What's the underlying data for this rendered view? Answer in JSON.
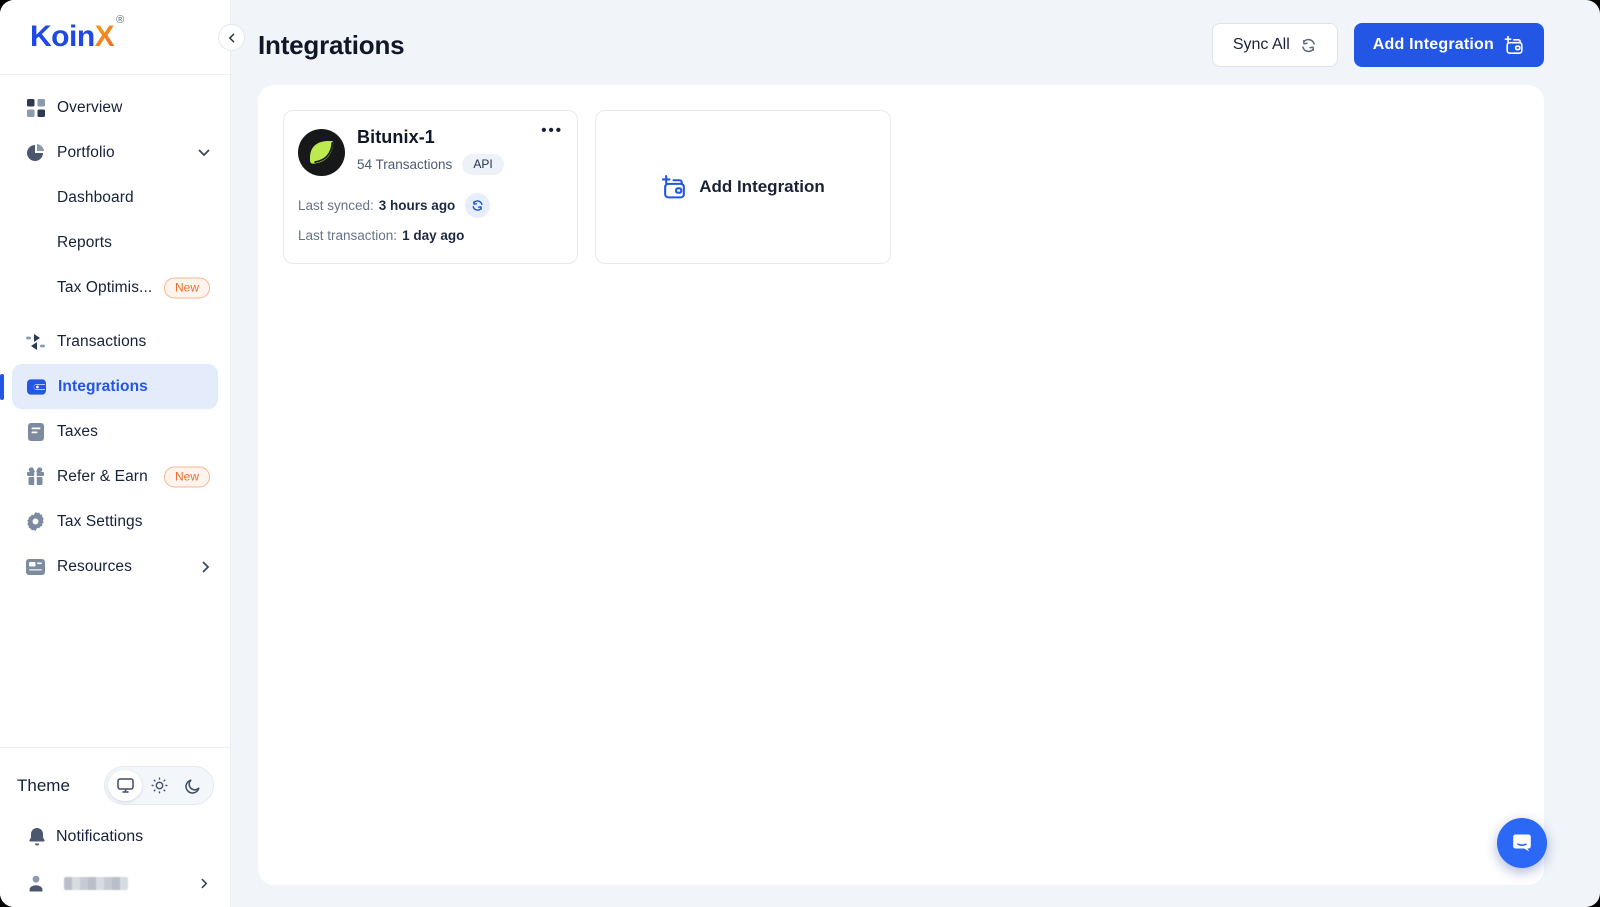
{
  "brand": {
    "name_left": "Koin",
    "name_right": "X",
    "registered_mark": "®"
  },
  "sidebar": {
    "items": [
      {
        "label": "Overview",
        "icon": "grid-icon"
      },
      {
        "label": "Portfolio",
        "icon": "pie-chart-icon",
        "chevron": "down"
      },
      {
        "label": "Dashboard"
      },
      {
        "label": "Reports"
      },
      {
        "label": "Tax Optimis...",
        "badge": "New"
      },
      {
        "label": "Transactions",
        "icon": "swap-arrows-icon"
      },
      {
        "label": "Integrations",
        "icon": "wallet-icon",
        "active": true
      },
      {
        "label": "Taxes",
        "icon": "document-icon"
      },
      {
        "label": "Refer & Earn",
        "icon": "gift-icon",
        "badge": "New"
      },
      {
        "label": "Tax Settings",
        "icon": "gear-icon"
      },
      {
        "label": "Resources",
        "icon": "newspaper-icon",
        "chevron": "right"
      }
    ],
    "theme": {
      "label": "Theme",
      "options": [
        "system",
        "light",
        "dark"
      ],
      "selected": "system"
    },
    "notifications_label": "Notifications"
  },
  "header": {
    "title": "Integrations",
    "sync_all_label": "Sync All",
    "add_integration_label": "Add Integration"
  },
  "integration_card": {
    "name": "Bitunix-1",
    "transactions_text": "54 Transactions",
    "method_badge": "API",
    "menu": "•••",
    "last_synced_label": "Last synced:",
    "last_synced_value": "3 hours ago",
    "last_transaction_label": "Last transaction:",
    "last_transaction_value": "1 day ago"
  },
  "add_card": {
    "label": "Add Integration"
  },
  "colors": {
    "primary_blue": "#2356e4",
    "active_item_bg": "#e4ecfb",
    "page_bg": "#f1f4f9",
    "badge_orange_text": "#ee6d2d",
    "bitunix_lime": "#bdeb4f",
    "text_dark": "#101828",
    "text_gray": "#66718a"
  }
}
